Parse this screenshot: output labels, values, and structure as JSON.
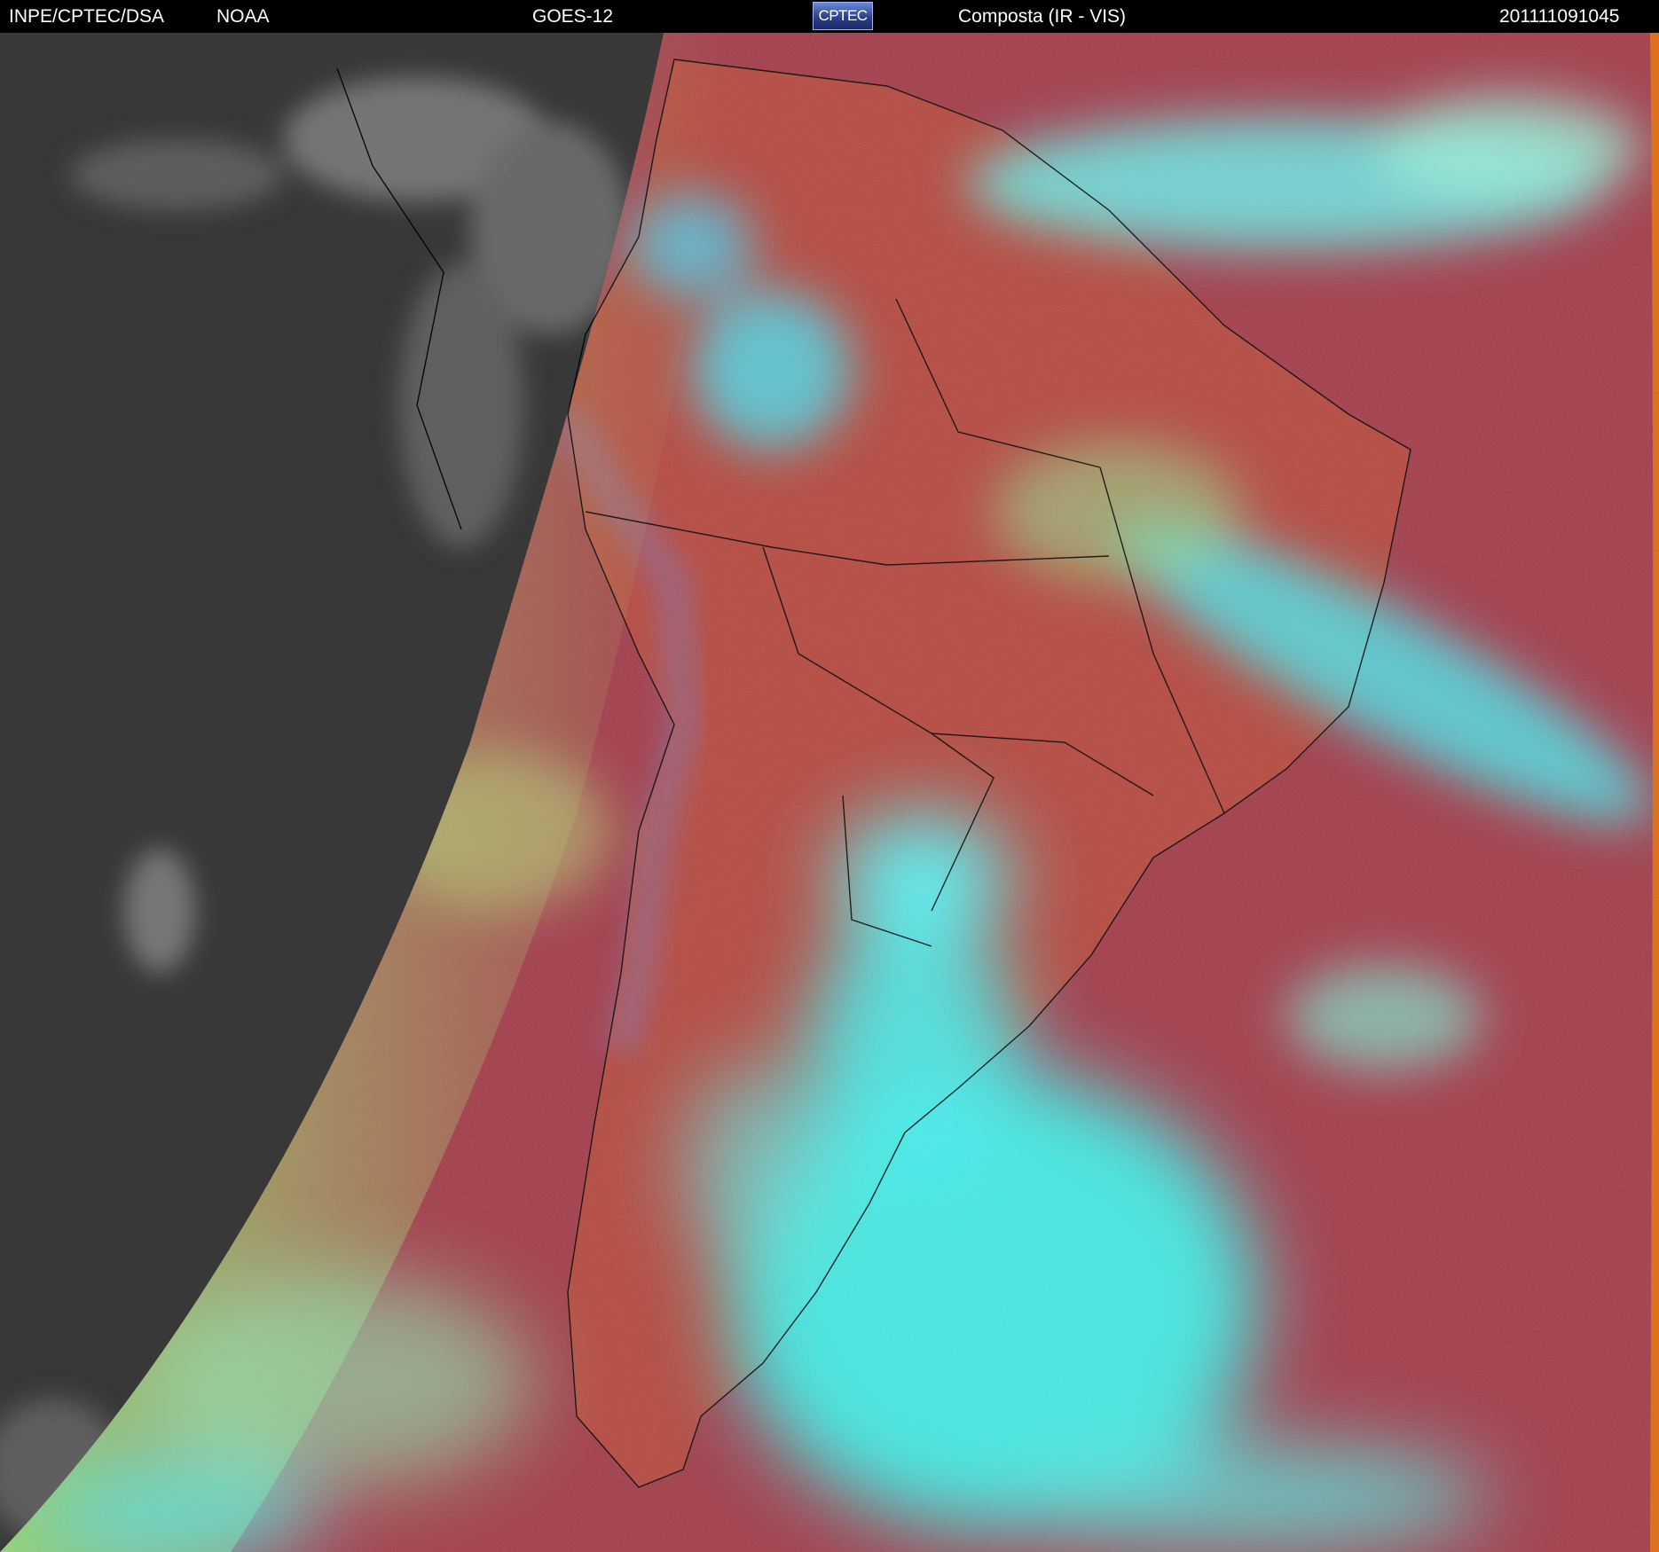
{
  "header": {
    "org": "INPE/CPTEC/DSA",
    "agency": "NOAA",
    "satellite": "GOES-12",
    "logo_text": "CPTEC",
    "product": "Composta (IR - VIS)",
    "timestamp": "201111091045"
  },
  "colors": {
    "background": "#000000",
    "header_text": "#ffffff",
    "land_ir": "#b5493f",
    "ocean_ir": "#a23c4c",
    "cloud_high": "#33f0f0",
    "cloud_mid": "#8ce87a",
    "night_side": "#3a3a3a",
    "coastline": "#000000"
  }
}
